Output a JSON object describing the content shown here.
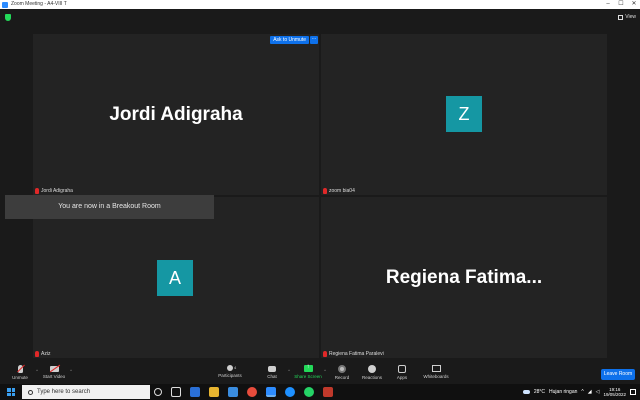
{
  "window": {
    "title": "Zoom Meeting - A4-VIII T"
  },
  "topbar": {
    "view_label": "View"
  },
  "tiles": [
    {
      "name": "Jordi Adigraha",
      "display": "Jordi Adigraha",
      "ask_unmute": "Ask to Unmute",
      "more": "···"
    },
    {
      "name": "zoom bia04",
      "avatar_letter": "Z"
    },
    {
      "name": "Aziz",
      "avatar_letter": "A"
    },
    {
      "name": "Regiena Fatima Paralevi",
      "display": "Regiena  Fatima..."
    }
  ],
  "breakout_banner": "You are now in a Breakout Room",
  "toolbar": {
    "unmute": "Unmute",
    "start_video": "Start Video",
    "participants": "Participants",
    "participants_count": "4",
    "chat": "Chat",
    "share_screen": "Share Screen",
    "record": "Record",
    "reactions": "Reactions",
    "apps": "Apps",
    "whiteboards": "Whiteboards",
    "leave_room": "Leave Room",
    "chevron": "^"
  },
  "taskbar": {
    "search_placeholder": "Type here to search",
    "temperature": "28°C",
    "weather": "Hujan ringan",
    "tray_arrow": "^",
    "time": "19:16",
    "date": "19/05/2022"
  },
  "colors": {
    "accent": "#0e71eb",
    "share": "#23d959",
    "avatar": "#1597a3",
    "muted": "#e02828"
  }
}
